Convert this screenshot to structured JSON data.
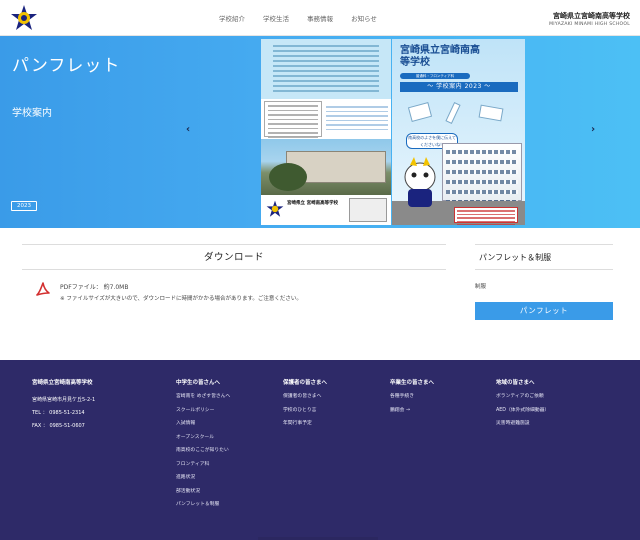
{
  "header": {
    "school_name_jp": "宮崎県立宮崎南高等学校",
    "school_name_en": "MIYAZAKI MINAMI HIGH SCHOOL",
    "nav": [
      "学校紹介",
      "学校生活",
      "事務情報",
      "お知らせ"
    ]
  },
  "hero": {
    "title": "パンフレット",
    "subtitle": "学校案内",
    "year": "2023",
    "pamphlet_cover": {
      "title": "宮崎県立宮崎南高等学校",
      "course": "普通科・フロンティア科",
      "banner": "〜 学校案内 2023 〜",
      "bubble": "南高校のよさを僕に伝えてくださいね！",
      "school_label": "宮崎県立 宮崎南高等学校"
    }
  },
  "download": {
    "heading": "ダウンロード",
    "file_label": "PDFファイル： 約7.0MB",
    "note": "※ ファイルサイズが大きいので、ダウンロードに時間がかかる場合があります。ご注意ください。"
  },
  "sidebar": {
    "heading": "パンフレット＆制服",
    "category": "制服",
    "button": "パンフレット"
  },
  "footer": {
    "school": {
      "name": "宮崎県立宮崎南高等学校",
      "address": "宮崎県宮崎市月見ケ丘5-2-1",
      "tel": "TEL ： 0985-51-2314",
      "fax": "FAX ： 0985-51-0607"
    },
    "columns": [
      {
        "heading": "中学生の皆さんへ",
        "items": [
          "宮崎南を めざす皆さんへ",
          "スクールポリシー",
          "入試情報",
          "オープンスクール",
          "南高校のここが知りたい",
          "フロンティア科",
          "進路状況",
          "部活動状況",
          "パンフレット＆制服"
        ]
      },
      {
        "heading": "保護者の皆さまへ",
        "items": [
          "保護者の皆さまへ",
          "学校のひとり言",
          "年間行事予定"
        ]
      },
      {
        "heading": "卒業生の皆さまへ",
        "items": [
          "各種手続き",
          "鵬翔会 →"
        ]
      },
      {
        "heading": "地域の皆さまへ",
        "items": [
          "ボランティアのご依頼",
          "AED（体外式除細動器）",
          "災害時避難施設"
        ]
      }
    ]
  },
  "colors": {
    "hero": "#45aaf0",
    "button": "#3a9be8",
    "footer": "#2e2a68"
  }
}
